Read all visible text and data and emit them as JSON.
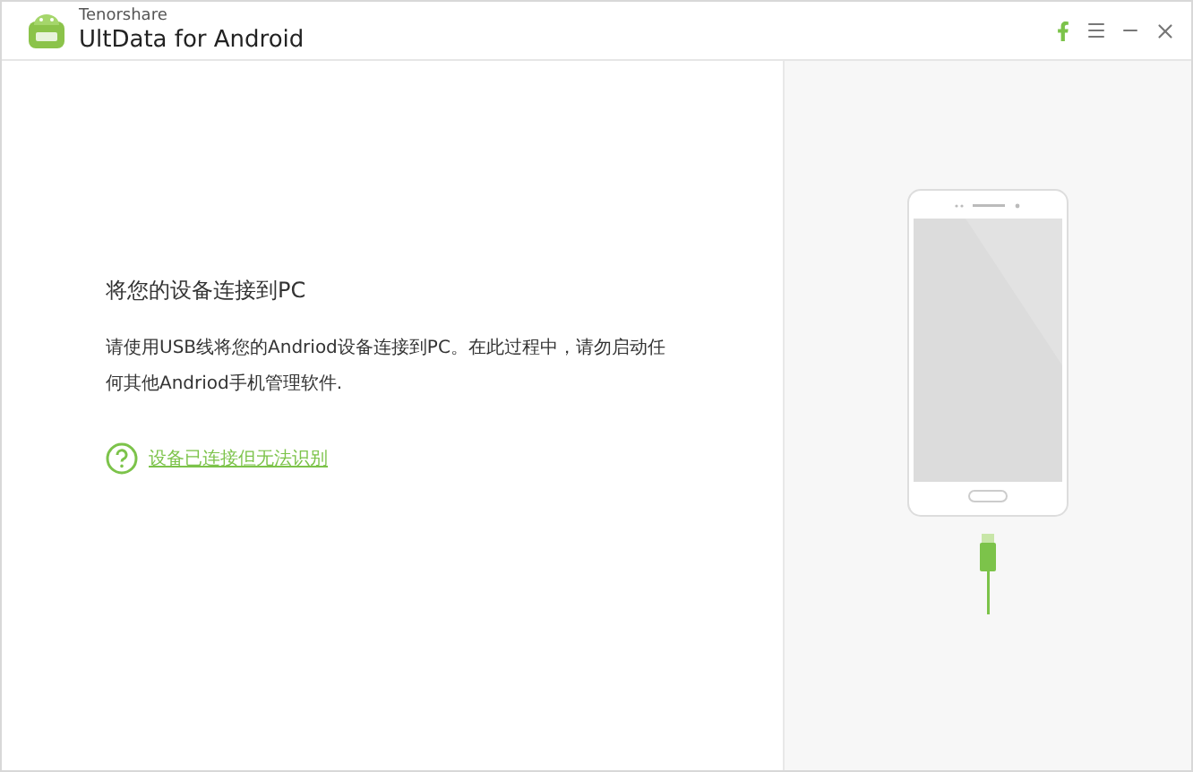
{
  "app": {
    "vendor": "Tenorshare",
    "name": "UltData for Android"
  },
  "content": {
    "heading": "将您的设备连接到PC",
    "description": "请使用USB线将您的Andriod设备连接到PC。在此过程中，请勿启动任何其他Andriod手机管理软件.",
    "help_link": "设备已连接但无法识别"
  }
}
